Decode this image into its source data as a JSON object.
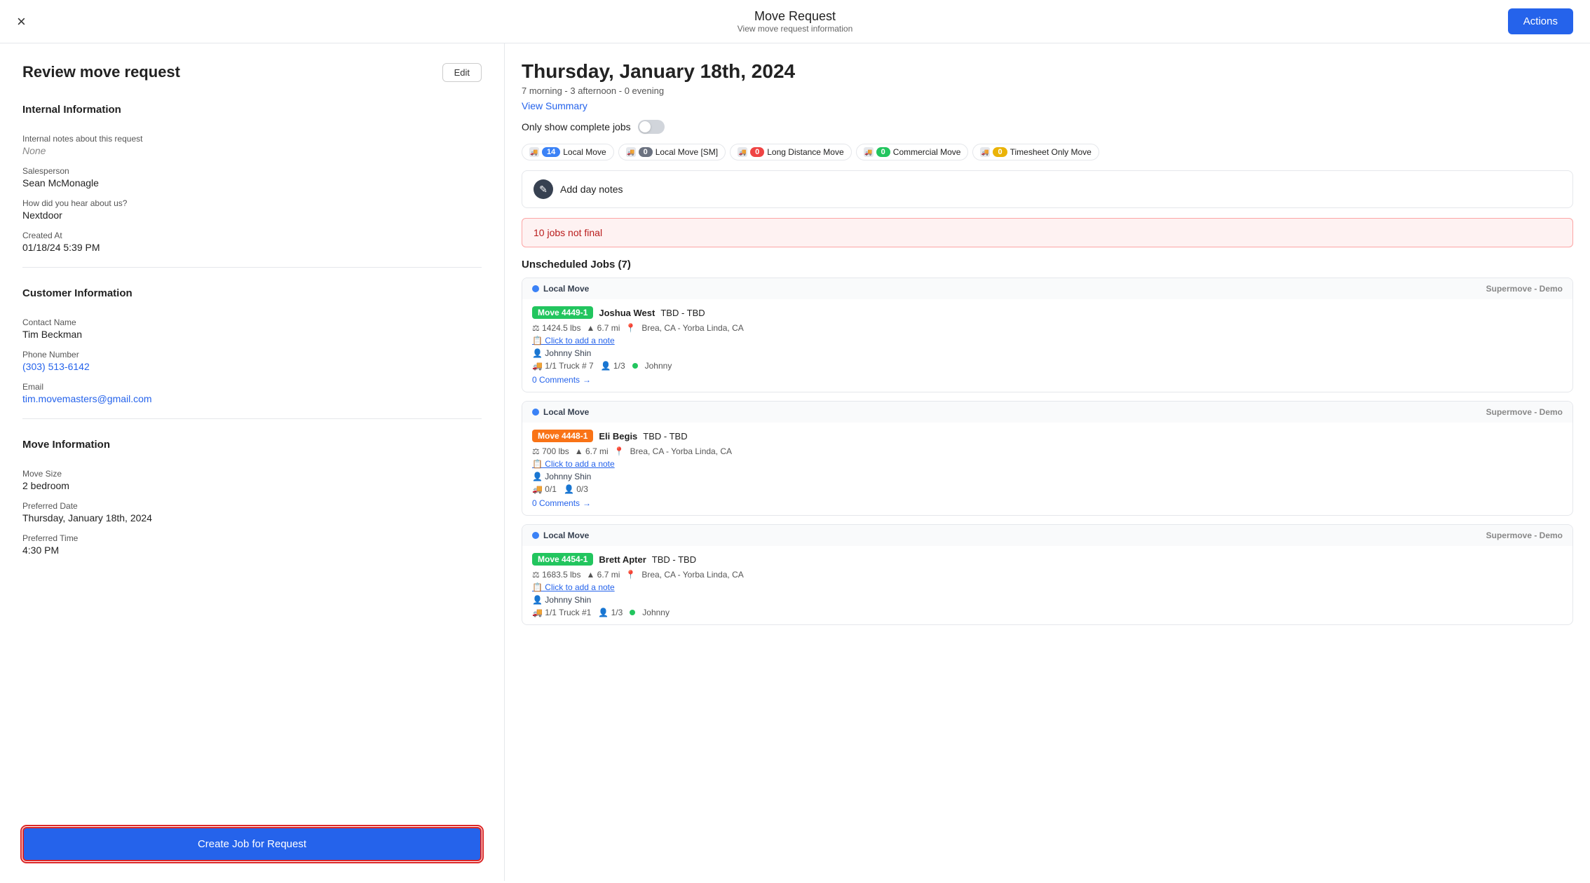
{
  "header": {
    "title": "Move Request",
    "subtitle": "View move request information",
    "close_label": "×",
    "actions_label": "Actions"
  },
  "left": {
    "page_title": "Review move request",
    "edit_label": "Edit",
    "internal": {
      "section": "Internal Information",
      "notes_label": "Internal notes about this request",
      "notes_value": "None",
      "salesperson_label": "Salesperson",
      "salesperson_value": "Sean McMonagle",
      "hear_label": "How did you hear about us?",
      "hear_value": "Nextdoor",
      "created_label": "Created At",
      "created_value": "01/18/24 5:39 PM"
    },
    "customer": {
      "section": "Customer Information",
      "name_label": "Contact Name",
      "name_value": "Tim Beckman",
      "phone_label": "Phone Number",
      "phone_value": "(303) 513-6142",
      "email_label": "Email",
      "email_value": "tim.movemasters@gmail.com"
    },
    "move": {
      "section": "Move Information",
      "size_label": "Move Size",
      "size_value": "2 bedroom",
      "date_label": "Preferred Date",
      "date_value": "Thursday, January 18th, 2024",
      "time_label": "Preferred Time",
      "time_value": "4:30 PM"
    },
    "create_job_label": "Create Job for Request"
  },
  "right": {
    "day_header": "Thursday, January 18th, 2024",
    "day_sub": "7 morning - 3 afternoon - 0 evening",
    "view_summary": "View Summary",
    "complete_jobs_label": "Only show complete jobs",
    "filters": [
      {
        "id": "local-move",
        "label": "Local Move",
        "count": "14",
        "color": "#3b82f6"
      },
      {
        "id": "local-move-sm",
        "label": "Local Move [SM]",
        "count": "0",
        "color": "#6b7280"
      },
      {
        "id": "long-distance",
        "label": "Long Distance Move",
        "count": "0",
        "color": "#ef4444"
      },
      {
        "id": "commercial",
        "label": "Commercial Move",
        "count": "0",
        "color": "#22c55e"
      },
      {
        "id": "timesheet",
        "label": "Timesheet Only Move",
        "count": "0",
        "color": "#eab308"
      }
    ],
    "add_notes_label": "Add day notes",
    "alert": "10 jobs not final",
    "unscheduled_header": "Unscheduled Jobs (7)",
    "jobs": [
      {
        "type": "Local Move",
        "company": "Supermove - Demo",
        "badge": "Move 4449-1",
        "badge_color": "green",
        "name": "Joshua West",
        "time": "TBD - TBD",
        "weight": "1424.5 lbs",
        "distance": "6.7 mi",
        "location": "Brea, CA - Yorba Linda, CA",
        "note": "Click to add a note",
        "person": "Johnny Shin",
        "truck": "1/1 Truck # 7",
        "crew": "1/3",
        "crew_dot": true,
        "crew_name": "Johnny",
        "comments": "0 Comments"
      },
      {
        "type": "Local Move",
        "company": "Supermove - Demo",
        "badge": "Move 4448-1",
        "badge_color": "orange",
        "name": "Eli Begis",
        "time": "TBD - TBD",
        "weight": "700 lbs",
        "distance": "6.7 mi",
        "location": "Brea, CA - Yorba Linda, CA",
        "note": "Click to add a note",
        "person": "Johnny Shin",
        "truck": "0/1",
        "crew": "0/3",
        "crew_dot": false,
        "crew_name": "",
        "comments": "0 Comments"
      },
      {
        "type": "Local Move",
        "company": "Supermove - Demo",
        "badge": "Move 4454-1",
        "badge_color": "green",
        "name": "Brett Apter",
        "time": "TBD - TBD",
        "weight": "1683.5 lbs",
        "distance": "6.7 mi",
        "location": "Brea, CA - Yorba Linda, CA",
        "note": "Click to add a note",
        "person": "Johnny Shin",
        "truck": "1/1 Truck #1",
        "crew": "1/3",
        "crew_dot": true,
        "crew_name": "Johnny",
        "comments": ""
      }
    ]
  }
}
